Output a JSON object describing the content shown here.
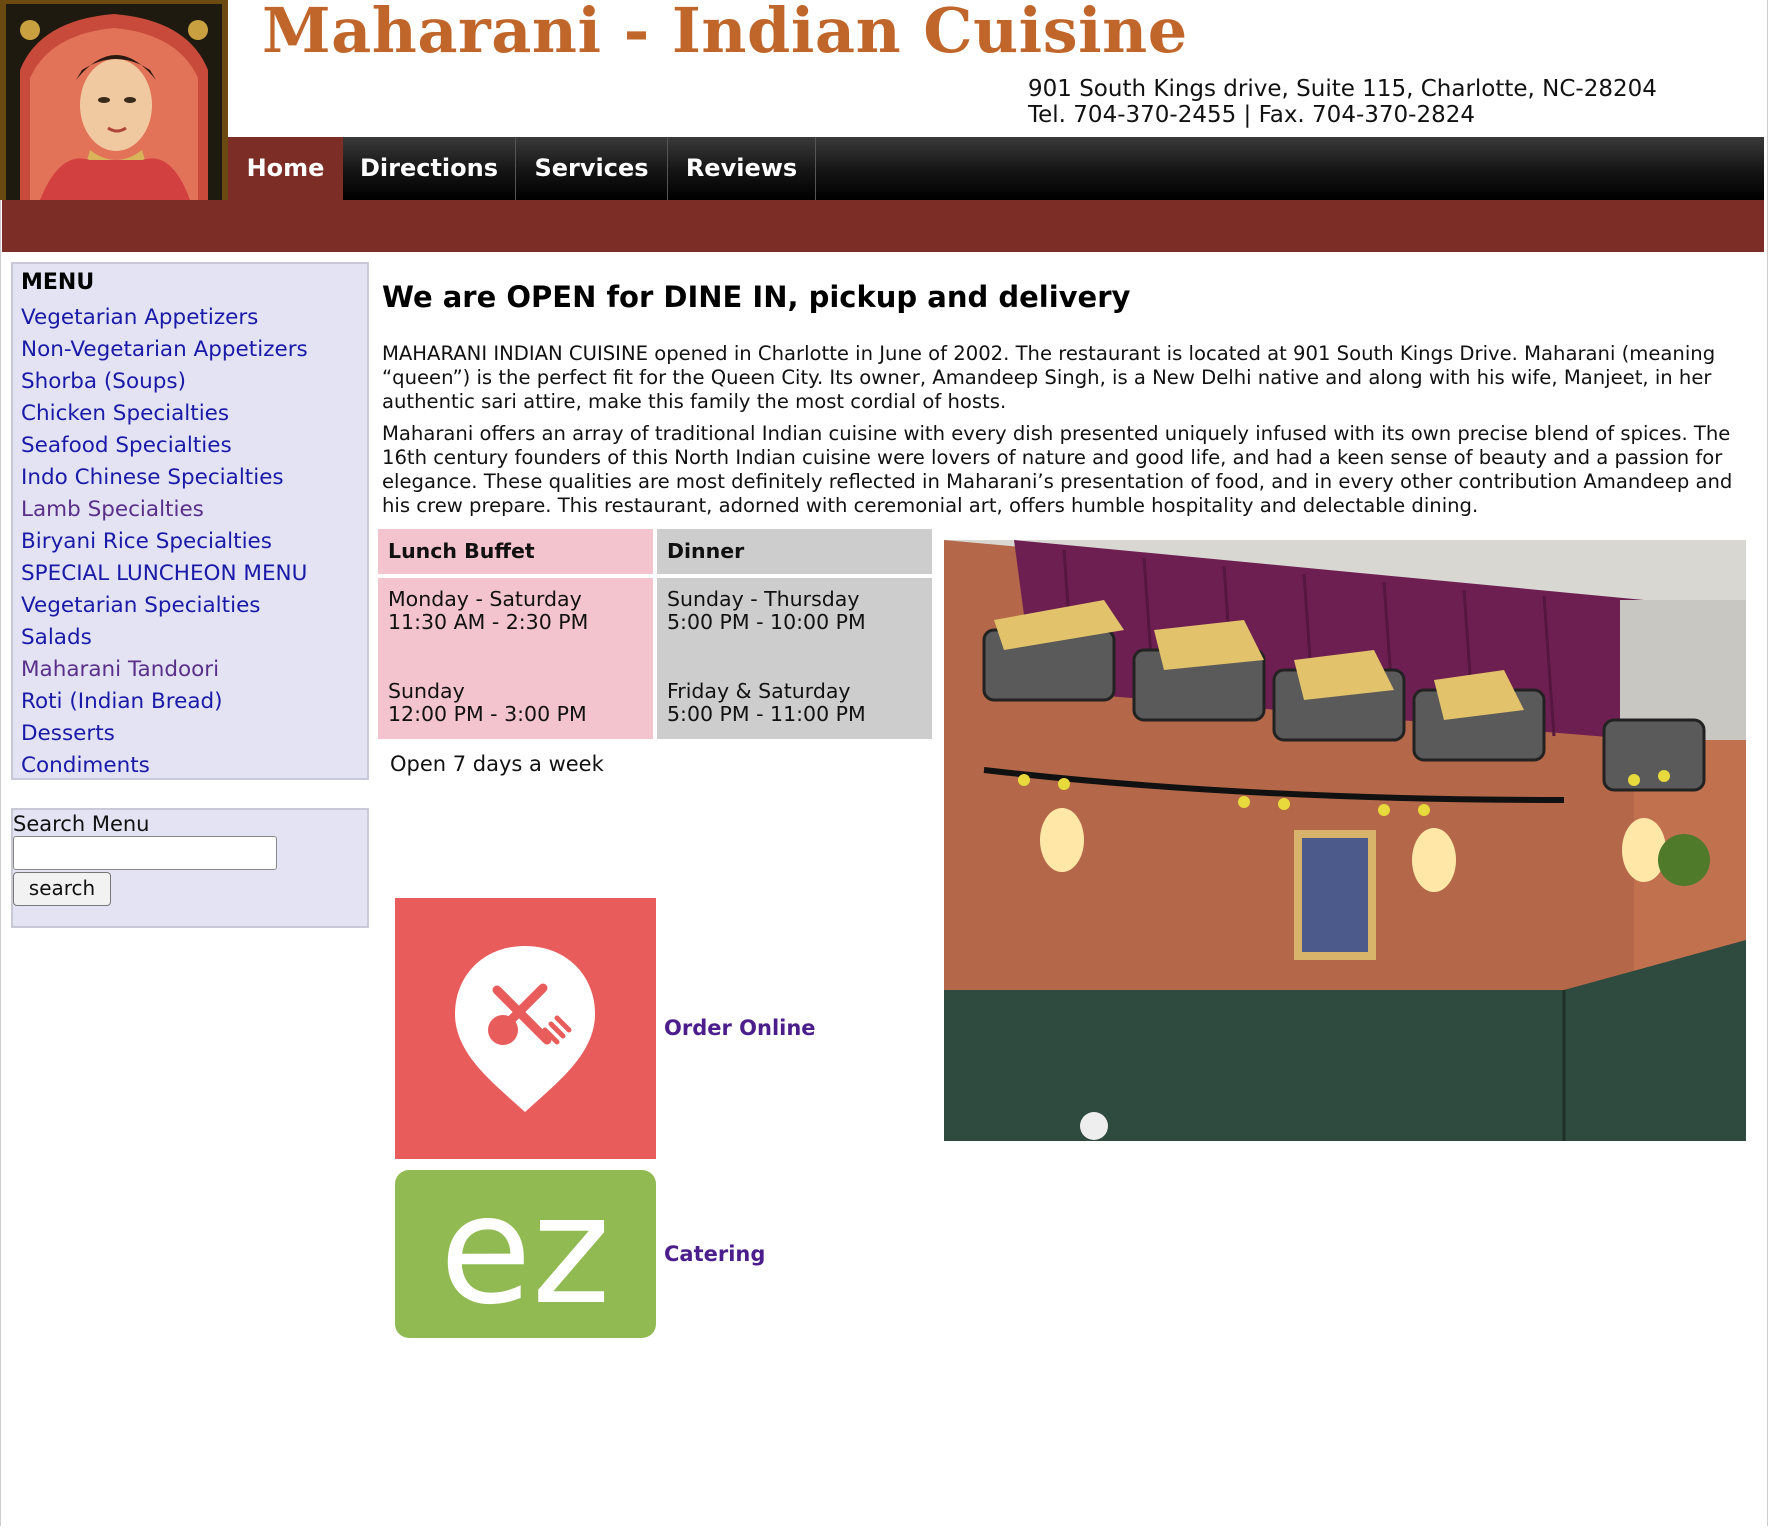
{
  "header": {
    "title": "Maharani - Indian Cuisine",
    "address_line": "901 South Kings drive, Suite 115, Charlotte, NC-28204",
    "phone_line": "Tel. 704-370-2455 | Fax. 704-370-2824"
  },
  "nav": {
    "home": "Home",
    "directions": "Directions",
    "services": "Services",
    "reviews": "Reviews"
  },
  "sidebar": {
    "title": "MENU",
    "items": [
      "Vegetarian Appetizers",
      "Non-Vegetarian Appetizers",
      "Shorba (Soups)",
      "Chicken Specialties",
      "Seafood Specialties",
      "Indo Chinese Specialties",
      "Lamb Specialties",
      "Biryani Rice Specialties",
      "SPECIAL LUNCHEON MENU",
      "Vegetarian Specialties",
      "Salads",
      "Maharani Tandoori",
      "Roti (Indian Bread)",
      "Desserts",
      "Condiments"
    ]
  },
  "search": {
    "label": "Search Menu",
    "value": "",
    "button": "search"
  },
  "main": {
    "headline": "We are OPEN for DINE IN, pickup and delivery",
    "paragraph1": "MAHARANI INDIAN CUISINE opened in Charlotte in June of 2002. The restaurant is located at 901 South Kings Drive. Maharani (meaning “queen”) is the perfect fit for the Queen City. Its owner, Amandeep Singh, is a New Delhi native and along with his wife, Manjeet, in her authentic sari attire, make this family the most cordial of hosts.",
    "paragraph2": "Maharani offers an array of traditional Indian cuisine with every dish presented uniquely infused with its own precise blend of spices. The 16th century founders of this North Indian cuisine were lovers of nature and good life, and had a keen sense of beauty and a passion for elegance. These qualities are most definitely reflected in Maharani’s presentation of food, and in every other contribution Amandeep and his crew prepare. This restaurant, adorned with ceremonial art, offers humble hospitality and delectable dining."
  },
  "hours": {
    "lunch_header": "Lunch Buffet",
    "dinner_header": "Dinner",
    "lunch": [
      {
        "days": "Monday - Saturday",
        "time": "11:30 AM - 2:30 PM"
      },
      {
        "days": "Sunday",
        "time": "12:00 PM - 3:00 PM"
      }
    ],
    "dinner": [
      {
        "days": "Sunday - Thursday",
        "time": "5:00 PM - 10:00 PM"
      },
      {
        "days": "Friday & Saturday",
        "time": "5:00 PM - 11:00 PM"
      }
    ],
    "note": "Open 7 days a week"
  },
  "links": {
    "order_online": "Order Online",
    "catering": "Catering",
    "ez_logo_text": "ez"
  },
  "colors": {
    "title": "#c0662a",
    "nav_active": "#7b2d26",
    "sidebar_bg": "#e3e3f4",
    "link": "#1a1aa8",
    "link_visited": "#5a2f8a",
    "lunch_bg": "#f3c4cd",
    "dinner_bg": "#cdcdcd",
    "order_tile": "#e85c5c",
    "ez_tile": "#91bb52"
  }
}
